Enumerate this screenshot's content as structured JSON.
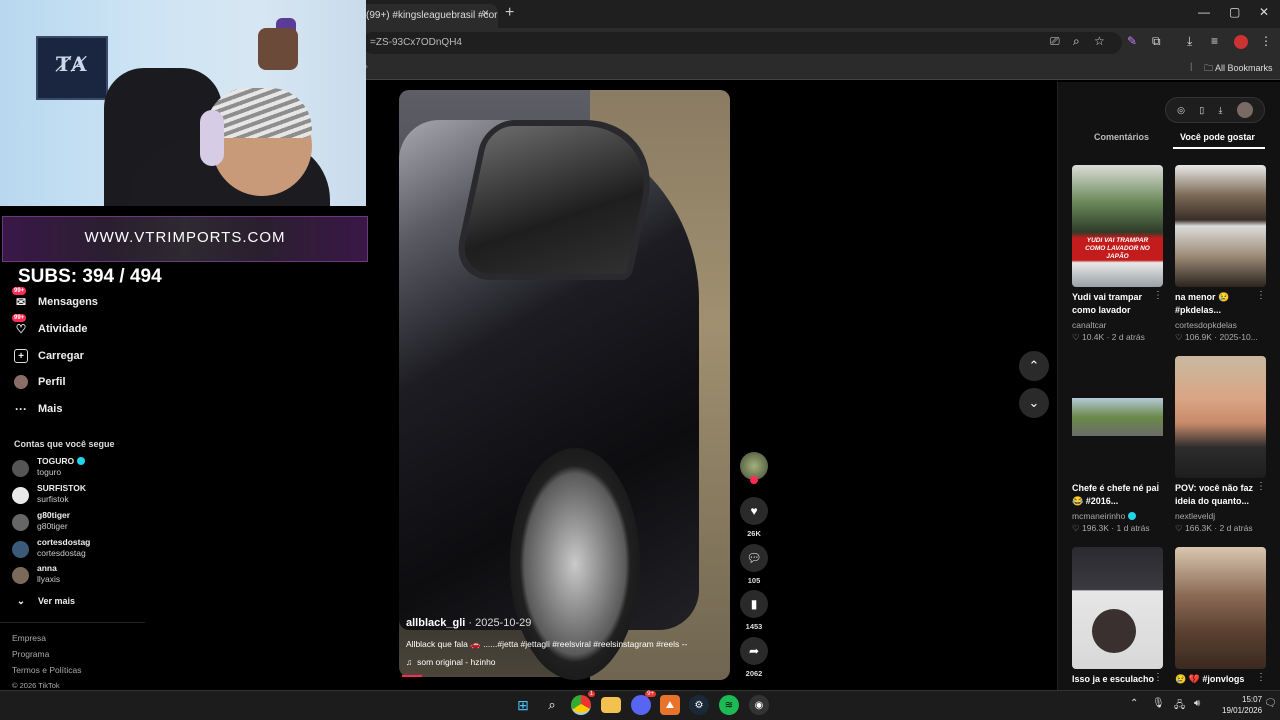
{
  "browser": {
    "tab_title": "(99+) #kingsleaguebrasil #corin",
    "tab_close": "×",
    "new_tab": "+",
    "url": "=ZS-93Cx7ODnQH4",
    "bookmarks_label": "All Bookmarks",
    "window_controls": [
      "—",
      "▢",
      "✕"
    ]
  },
  "stream_overlay": {
    "banner": "WWW.VTRIMPORTS.COM",
    "subs_label": "SUBS:",
    "subs_value": "394 / 494"
  },
  "sidebar": {
    "nav": [
      {
        "label": "Mensagens",
        "badge": "99+"
      },
      {
        "label": "Atividade",
        "badge": "99+"
      },
      {
        "label": "Carregar"
      },
      {
        "label": "Perfil"
      },
      {
        "label": "Mais"
      }
    ],
    "following_title": "Contas que você segue",
    "accounts": [
      {
        "name": "TOGURO",
        "handle": "toguro",
        "verified": true
      },
      {
        "name": "SURFISTOK",
        "handle": "surfistok"
      },
      {
        "name": "g80tiger",
        "handle": "g80tiger"
      },
      {
        "name": "cortesdostag",
        "handle": "cortesdostag"
      },
      {
        "name": "anna",
        "handle": "llyaxis"
      }
    ],
    "see_more": "Ver mais",
    "footer": [
      "Empresa",
      "Programa",
      "Termos e Políticas",
      "© 2026 TikTok"
    ]
  },
  "video": {
    "username": "allblack_gli",
    "date": " · 2025-10-29",
    "caption": "Allblack que fala 🚗 ......#jetta #jettagli #reelsviral #reelsinstagram #reels --",
    "music": "som original - hzinho",
    "likes": "26K",
    "comments": "105",
    "saves": "1453",
    "shares": "2062"
  },
  "right_panel": {
    "tabs": [
      "Comentários",
      "Você pode gostar"
    ],
    "cards": [
      {
        "title": "Yudi vai trampar como lavador",
        "author": "canaltcar",
        "views": "10.4K",
        "age": "2 d atrás",
        "thumb_text": "YUDI VAI TRAMPAR COMO LAVADOR NO JAPÃO"
      },
      {
        "title": "na menor 😢 #pkdelas...",
        "author": "cortesdopkdelas",
        "views": "106.9K",
        "age": "2025-10...",
        "thumb_text": ""
      },
      {
        "title": "Chefe é chefe né pai 😂 #2016...",
        "author": "mcmaneirinho",
        "views": "196.3K",
        "age": "1 d atrás",
        "thumb_text": ""
      },
      {
        "title": "POV: você não faz ideia do quanto...",
        "author": "nextleveldj",
        "views": "166.3K",
        "age": "2 d atrás",
        "thumb_text": ""
      },
      {
        "title": "Isso ja e esculacho",
        "author": "",
        "views": "",
        "age": "",
        "thumb_text": ""
      },
      {
        "title": "😢 💔 #jonvlogs",
        "author": "",
        "views": "",
        "age": "",
        "thumb_text": ""
      }
    ]
  },
  "taskbar": {
    "time": "15:07",
    "date": "19/01/2026",
    "badges": {
      "chrome": "1",
      "discord": "9+"
    }
  },
  "colors": {
    "accent": "#fe2c55",
    "verified": "#20d5ec"
  }
}
